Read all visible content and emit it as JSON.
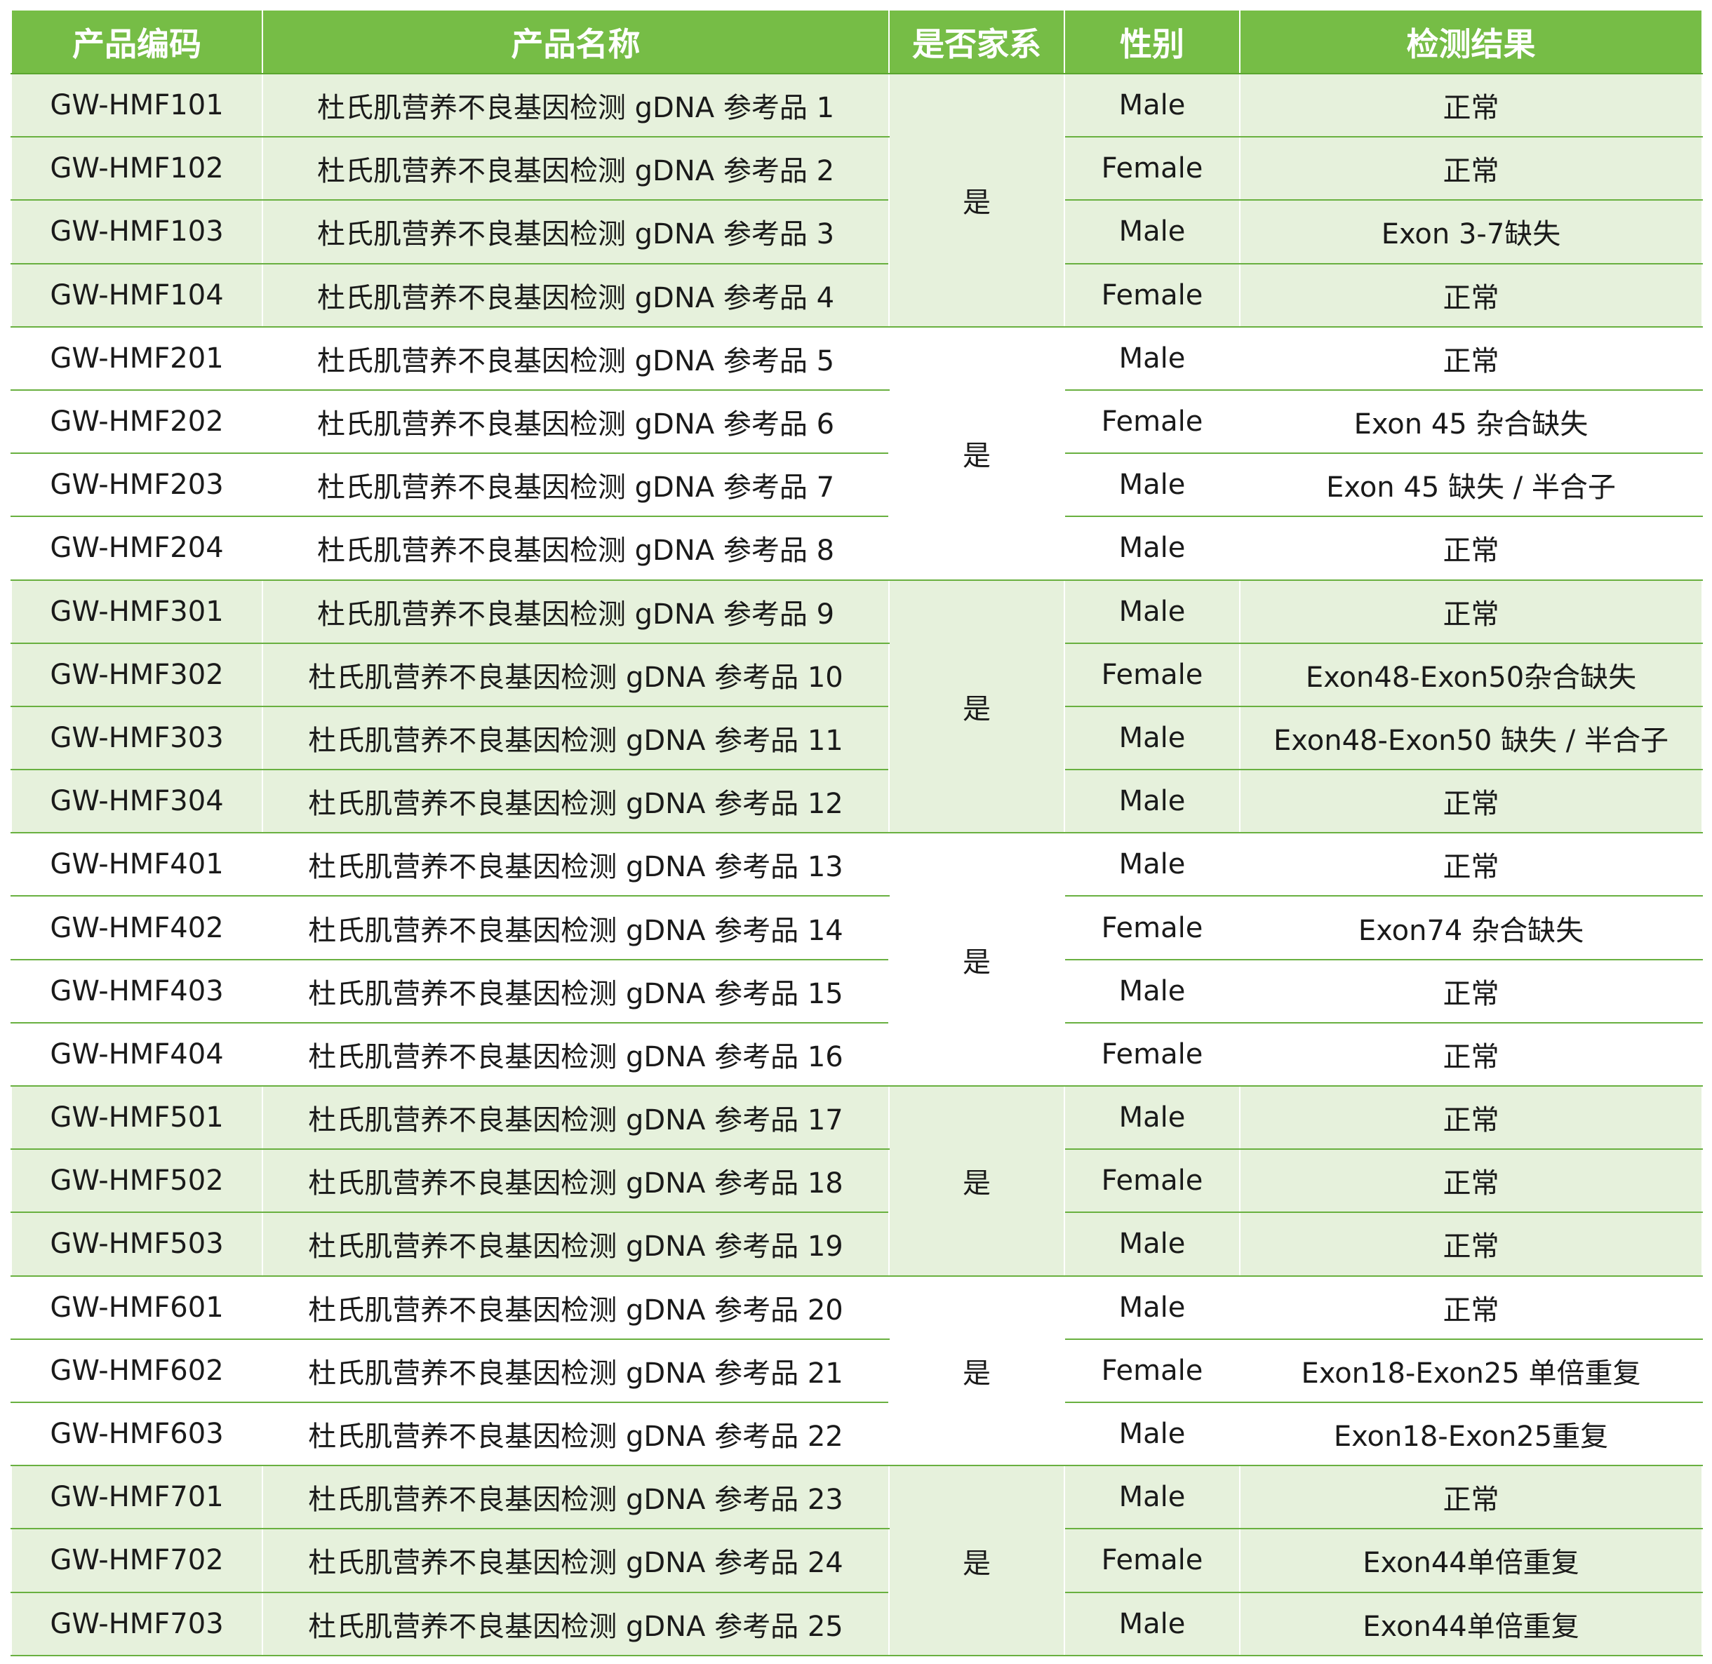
{
  "headers": [
    "产品编码",
    "产品名称",
    "是否家系",
    "性别",
    "检测结果"
  ],
  "groups": [
    {
      "family": "是",
      "rows": [
        {
          "code": "GW-HMF101",
          "name": "杜氏肌营养不良基因检测 gDNA 参考品 1",
          "sex": "Male",
          "result": "正常"
        },
        {
          "code": "GW-HMF102",
          "name": "杜氏肌营养不良基因检测 gDNA 参考品 2",
          "sex": "Female",
          "result": "正常"
        },
        {
          "code": "GW-HMF103",
          "name": "杜氏肌营养不良基因检测 gDNA 参考品 3",
          "sex": "Male",
          "result": "Exon 3-7缺失"
        },
        {
          "code": "GW-HMF104",
          "name": "杜氏肌营养不良基因检测 gDNA 参考品 4",
          "sex": "Female",
          "result": "正常"
        }
      ]
    },
    {
      "family": "是",
      "rows": [
        {
          "code": "GW-HMF201",
          "name": "杜氏肌营养不良基因检测 gDNA 参考品 5",
          "sex": "Male",
          "result": "正常"
        },
        {
          "code": "GW-HMF202",
          "name": "杜氏肌营养不良基因检测 gDNA 参考品 6",
          "sex": "Female",
          "result": "Exon 45 杂合缺失"
        },
        {
          "code": "GW-HMF203",
          "name": "杜氏肌营养不良基因检测 gDNA 参考品 7",
          "sex": "Male",
          "result": "Exon 45 缺失 / 半合子"
        },
        {
          "code": "GW-HMF204",
          "name": "杜氏肌营养不良基因检测 gDNA 参考品 8",
          "sex": "Male",
          "result": "正常"
        }
      ]
    },
    {
      "family": "是",
      "rows": [
        {
          "code": "GW-HMF301",
          "name": "杜氏肌营养不良基因检测 gDNA 参考品 9",
          "sex": "Male",
          "result": "正常"
        },
        {
          "code": "GW-HMF302",
          "name": "杜氏肌营养不良基因检测 gDNA 参考品 10",
          "sex": "Female",
          "result": "Exon48-Exon50杂合缺失"
        },
        {
          "code": "GW-HMF303",
          "name": "杜氏肌营养不良基因检测 gDNA 参考品 11",
          "sex": "Male",
          "result": "Exon48-Exon50 缺失 / 半合子"
        },
        {
          "code": "GW-HMF304",
          "name": "杜氏肌营养不良基因检测 gDNA 参考品 12",
          "sex": "Male",
          "result": "正常"
        }
      ]
    },
    {
      "family": "是",
      "rows": [
        {
          "code": "GW-HMF401",
          "name": "杜氏肌营养不良基因检测 gDNA 参考品 13",
          "sex": "Male",
          "result": "正常"
        },
        {
          "code": "GW-HMF402",
          "name": "杜氏肌营养不良基因检测 gDNA 参考品 14",
          "sex": "Female",
          "result": "Exon74 杂合缺失"
        },
        {
          "code": "GW-HMF403",
          "name": "杜氏肌营养不良基因检测 gDNA 参考品 15",
          "sex": "Male",
          "result": "正常"
        },
        {
          "code": "GW-HMF404",
          "name": "杜氏肌营养不良基因检测 gDNA 参考品 16",
          "sex": "Female",
          "result": "正常"
        }
      ]
    },
    {
      "family": "是",
      "rows": [
        {
          "code": "GW-HMF501",
          "name": "杜氏肌营养不良基因检测 gDNA 参考品 17",
          "sex": "Male",
          "result": "正常"
        },
        {
          "code": "GW-HMF502",
          "name": "杜氏肌营养不良基因检测 gDNA 参考品 18",
          "sex": "Female",
          "result": "正常"
        },
        {
          "code": "GW-HMF503",
          "name": "杜氏肌营养不良基因检测 gDNA 参考品 19",
          "sex": "Male",
          "result": "正常"
        }
      ]
    },
    {
      "family": "是",
      "rows": [
        {
          "code": "GW-HMF601",
          "name": "杜氏肌营养不良基因检测 gDNA 参考品 20",
          "sex": "Male",
          "result": "正常"
        },
        {
          "code": "GW-HMF602",
          "name": "杜氏肌营养不良基因检测 gDNA 参考品 21",
          "sex": "Female",
          "result": "Exon18-Exon25 单倍重复"
        },
        {
          "code": "GW-HMF603",
          "name": "杜氏肌营养不良基因检测 gDNA 参考品 22",
          "sex": "Male",
          "result": "Exon18-Exon25重复"
        }
      ]
    },
    {
      "family": "是",
      "rows": [
        {
          "code": "GW-HMF701",
          "name": "杜氏肌营养不良基因检测 gDNA 参考品 23",
          "sex": "Male",
          "result": "正常"
        },
        {
          "code": "GW-HMF702",
          "name": "杜氏肌营养不良基因检测 gDNA 参考品 24",
          "sex": "Female",
          "result": "Exon44单倍重复"
        },
        {
          "code": "GW-HMF703",
          "name": "杜氏肌营养不良基因检测 gDNA 参考品 25",
          "sex": "Male",
          "result": "Exon44单倍重复"
        }
      ]
    }
  ],
  "colors": {
    "header_bg": "#76bd46",
    "shade_bg": "#e6f1dc",
    "rule": "#69b040"
  }
}
